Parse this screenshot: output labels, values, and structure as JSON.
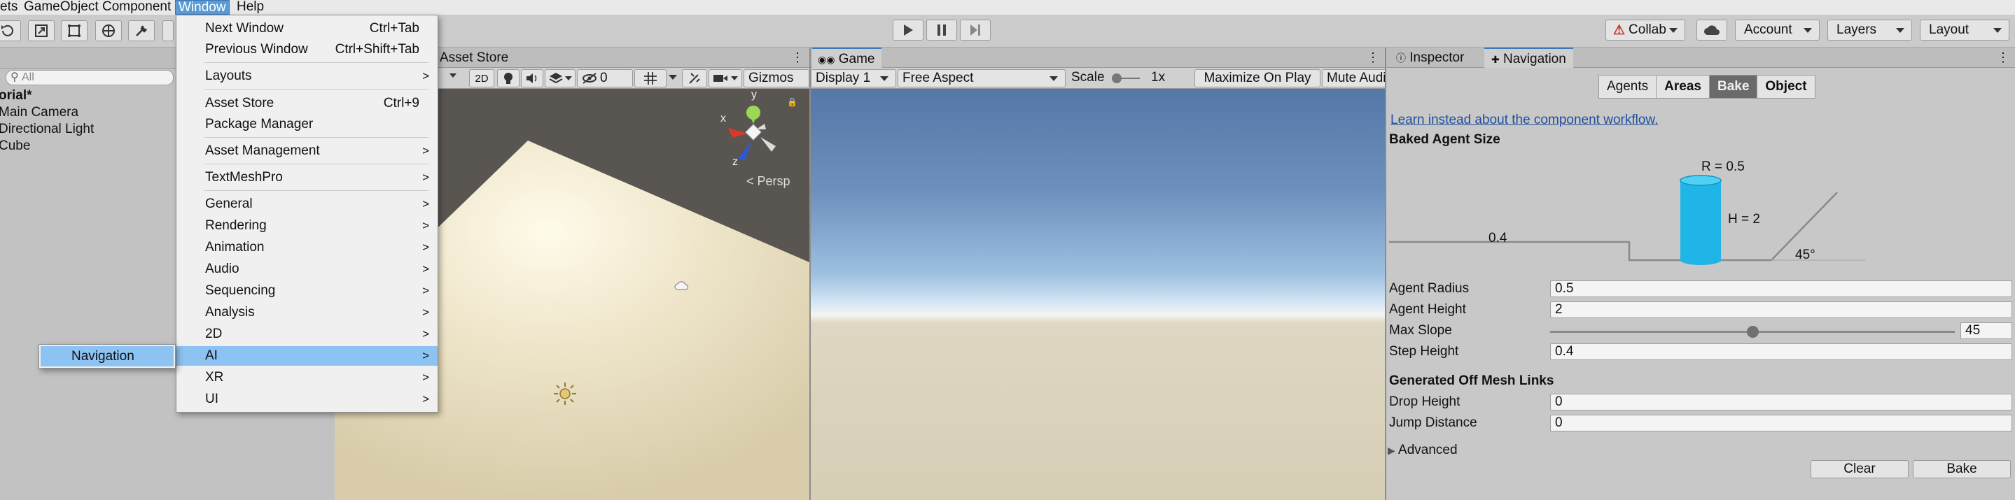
{
  "menubar": {
    "items": [
      "ets",
      "GameObject",
      "Component",
      "Window",
      "Help"
    ]
  },
  "toolbar": {
    "collab": "Collab",
    "account": "Account",
    "layers": "Layers",
    "layout": "Layout"
  },
  "hierarchy": {
    "search_placeholder": "All",
    "scene": "orial*",
    "items": [
      "Main Camera",
      "Directional Light",
      "Cube"
    ]
  },
  "scene_view": {
    "tab": "Asset Store",
    "btn_2d": "2D",
    "hidden_count": "0",
    "gizmos": "Gizmos",
    "gizmo_y": "y",
    "gizmo_x": "x",
    "gizmo_z": "z",
    "persp": "< Persp"
  },
  "game_view": {
    "tab": "Game",
    "display": "Display 1",
    "aspect": "Free Aspect",
    "scale_label": "Scale",
    "scale_value": "1x",
    "maximize": "Maximize On Play",
    "mute": "Mute Audi"
  },
  "window_menu": {
    "items": [
      {
        "label": "Next Window",
        "shortcut": "Ctrl+Tab"
      },
      {
        "label": "Previous Window",
        "shortcut": "Ctrl+Shift+Tab"
      },
      {
        "label": "Layouts",
        "sub": ">"
      },
      {
        "label": "Asset Store",
        "shortcut": "Ctrl+9"
      },
      {
        "label": "Package Manager"
      },
      {
        "label": "Asset Management",
        "sub": ">"
      },
      {
        "label": "TextMeshPro",
        "sub": ">"
      },
      {
        "label": "General",
        "sub": ">"
      },
      {
        "label": "Rendering",
        "sub": ">"
      },
      {
        "label": "Animation",
        "sub": ">"
      },
      {
        "label": "Audio",
        "sub": ">"
      },
      {
        "label": "Sequencing",
        "sub": ">"
      },
      {
        "label": "Analysis",
        "sub": ">"
      },
      {
        "label": "2D",
        "sub": ">"
      },
      {
        "label": "AI",
        "sub": ">"
      },
      {
        "label": "XR",
        "sub": ">"
      },
      {
        "label": "UI",
        "sub": ">"
      }
    ],
    "highlighted": "AI"
  },
  "ai_submenu": {
    "items": [
      "Navigation"
    ]
  },
  "right_panel": {
    "tabs": [
      "Inspector",
      "Navigation"
    ],
    "nav_tabs": [
      "Agents",
      "Areas",
      "Bake",
      "Object"
    ],
    "selected_nav_tab": "Bake",
    "workflow_link": "Learn instead about the component workflow.",
    "baked_agent_size": "Baked Agent Size",
    "diagram": {
      "r": "R = 0.5",
      "h": "H = 2",
      "step": "0.4",
      "angle": "45°"
    },
    "fields": [
      {
        "label": "Agent Radius",
        "value": "0.5"
      },
      {
        "label": "Agent Height",
        "value": "2"
      },
      {
        "label": "Max Slope",
        "value": "45"
      },
      {
        "label": "Step Height",
        "value": "0.4"
      }
    ],
    "max_slope_fraction": 0.5,
    "offmesh_title": "Generated Off Mesh Links",
    "offmesh_fields": [
      {
        "label": "Drop Height",
        "value": "0"
      },
      {
        "label": "Jump Distance",
        "value": "0"
      }
    ],
    "advanced": "Advanced",
    "clear_button": "Clear",
    "bake_button": "Bake"
  }
}
